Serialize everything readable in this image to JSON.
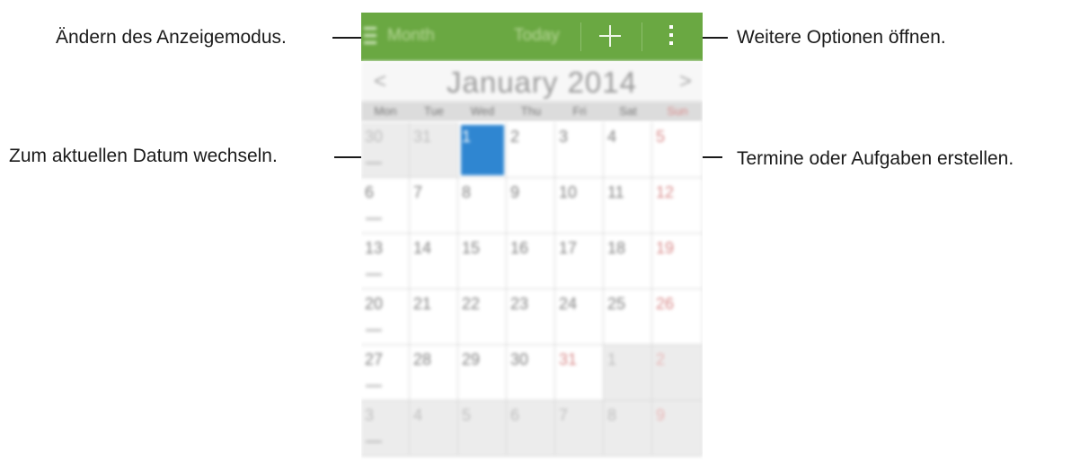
{
  "callouts": {
    "view_mode": "Ändern des Anzeigemodus.",
    "today": "Zum aktuellen Datum wechseln.",
    "more_options": "Weitere Optionen öffnen.",
    "create": "Termine oder Aufgaben erstellen."
  },
  "action_bar": {
    "view_label": "Month",
    "today_label": "Today",
    "color": "#6aa842"
  },
  "month_nav": {
    "title": "January 2014",
    "prev": "<",
    "next": ">"
  },
  "weekdays": [
    "Mon",
    "Tue",
    "Wed",
    "Thu",
    "Fri",
    "Sat",
    "Sun"
  ],
  "weeks": [
    [
      "30",
      "31",
      "1",
      "2",
      "3",
      "4",
      "5"
    ],
    [
      "6",
      "7",
      "8",
      "9",
      "10",
      "11",
      "12"
    ],
    [
      "13",
      "14",
      "15",
      "16",
      "17",
      "18",
      "19"
    ],
    [
      "20",
      "21",
      "22",
      "23",
      "24",
      "25",
      "26"
    ],
    [
      "27",
      "28",
      "29",
      "30",
      "31",
      "1",
      "2"
    ],
    [
      "3",
      "4",
      "5",
      "6",
      "7",
      "8",
      "9"
    ]
  ],
  "today": "1",
  "accent": "#2f86d1"
}
